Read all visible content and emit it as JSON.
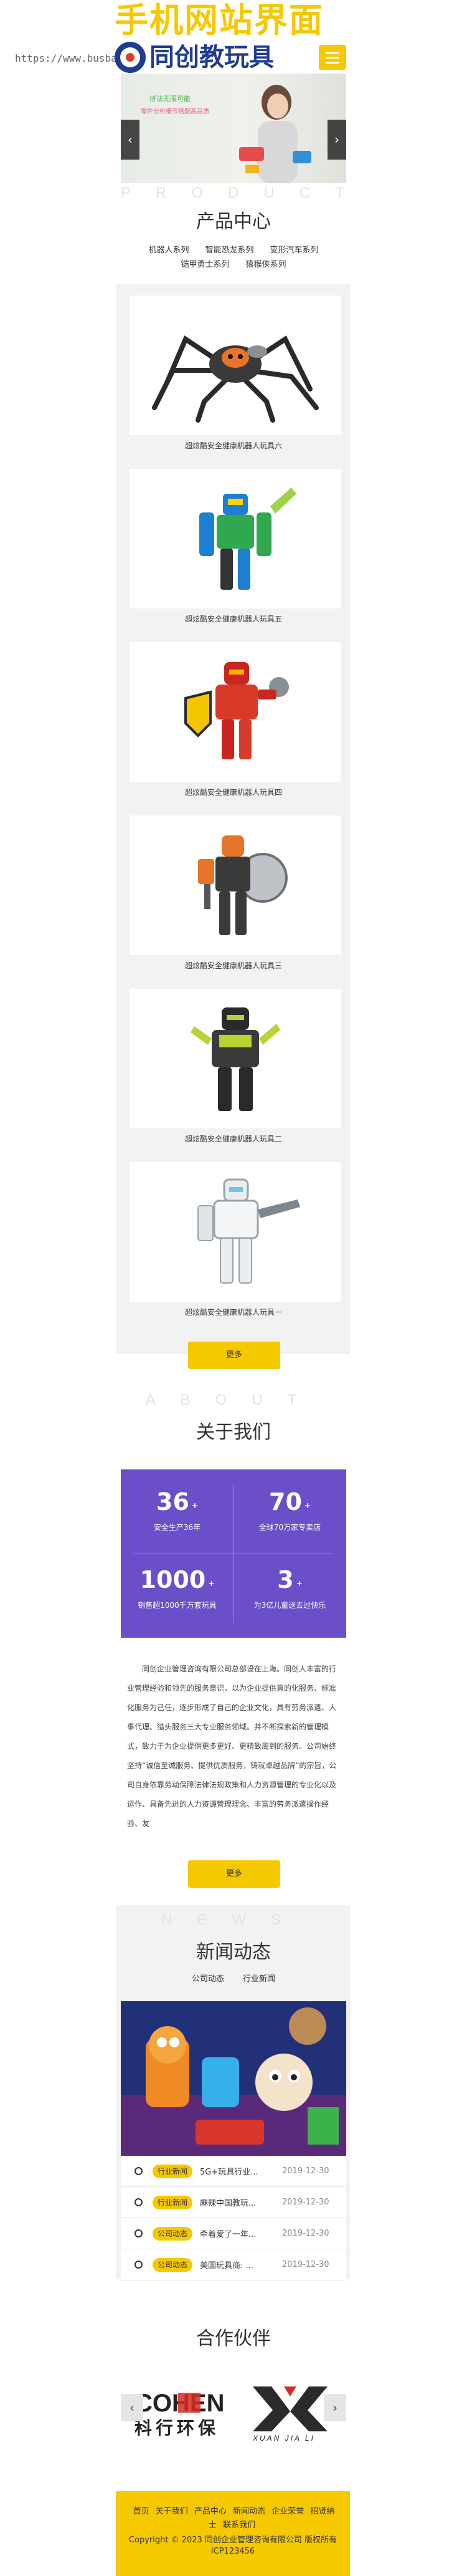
{
  "header": {
    "url": "https://www.busbar.",
    "promo_title": "手机网站界面",
    "brand_name": "同创教玩具"
  },
  "banner": {
    "text1": "拼法无限可能",
    "text2": "零件分析细节搭配高品质",
    "prev": "‹",
    "next": "›"
  },
  "products": {
    "en": "PRODUCT",
    "cn": "产品中心",
    "categories_row1": [
      "机器人系列",
      "智能恐龙系列",
      "变形汽车系列"
    ],
    "categories_row2": [
      "铠甲勇士系列",
      "猿猴侠系列"
    ],
    "items": [
      {
        "title": "超炫酷安全健康机器人玩具六"
      },
      {
        "title": "超炫酷安全健康机器人玩具五"
      },
      {
        "title": "超炫酷安全健康机器人玩具四"
      },
      {
        "title": "超炫酷安全健康机器人玩具三"
      },
      {
        "title": "超炫酷安全健康机器人玩具二"
      },
      {
        "title": "超炫酷安全健康机器人玩具一"
      }
    ],
    "more": "更多"
  },
  "about": {
    "en": "ABOUT",
    "cn": "关于我们",
    "stats": [
      {
        "num": "36",
        "sup": "+",
        "label": "安全生产36年"
      },
      {
        "num": "70",
        "sup": "+",
        "label": "全球70万家专卖店"
      },
      {
        "num": "1000",
        "sup": "+",
        "label": "销售超1000千万套玩具"
      },
      {
        "num": "3",
        "sup": "+",
        "label": "为3亿儿童送去过快乐"
      }
    ],
    "text": "同创企业管理咨询有限公司总部设在上海。同创人丰富的行业管理经验和领先的服务意识，以为企业提供真的化服务、标准化服务为己任，逐步形成了自己的企业文化，具有劳务派遣、人事代理、猎头服务三大专业服务领域。并不断探索新的管理模式，致力于为企业提供更多更好、更精致周到的服务。公司始终坚持“诚信至诚服务、提供优质服务，铸就卓越品牌”的宗旨，公司自身依靠劳动保障法律法规政策和人力资源管理的专业化以及运作、具备先进的人力资源管理理念、丰富的劳务派遣操作经验、友",
    "more": "更多"
  },
  "news": {
    "en": "NEWS",
    "cn": "新闻动态",
    "tabs": [
      "公司动态",
      "行业新闻"
    ],
    "items": [
      {
        "badge": "行业新闻",
        "title": "5G+玩具行业...",
        "date": "2019-12-30"
      },
      {
        "badge": "行业新闻",
        "title": "麻辣中国教玩...",
        "date": "2019-12-30"
      },
      {
        "badge": "公司动态",
        "title": "牵着爱了一年...",
        "date": "2019-12-30"
      },
      {
        "badge": "公司动态",
        "title": "美国玩具商: ...",
        "date": "2019-12-30"
      }
    ]
  },
  "partners": {
    "cn": "合作伙伴",
    "cohen_text": "COHEN",
    "cohen_cn": "科行环保",
    "xjl_text": "XUAN JIA LI",
    "prev": "‹",
    "next": "›"
  },
  "footer": {
    "links": [
      "首页",
      "关于我们",
      "产品中心",
      "新闻动态",
      "企业荣誉",
      "招贤纳士",
      "联系我们"
    ],
    "copyright": "Copyright © 2023 同创企业管理咨询有限公司 版权所有 ICP123456"
  },
  "colors": {
    "accent": "#f6c800",
    "brand": "#1f3d8f",
    "stats_bg": "#6a4fc9",
    "panel_bg": "#f2f2f2"
  }
}
